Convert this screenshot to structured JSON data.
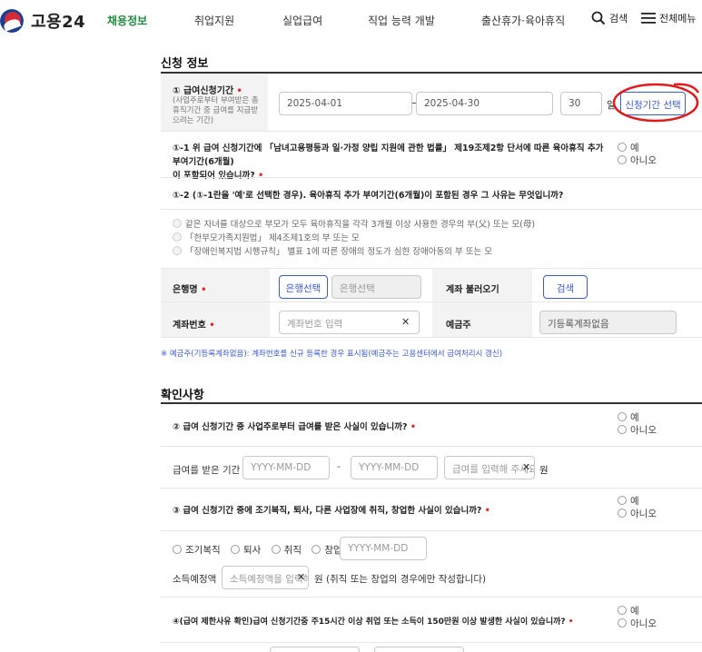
{
  "header": {
    "logo_text": "고용24",
    "nav": [
      "채용정보",
      "취업지원",
      "실업급여",
      "직업 능력 개발",
      "출산휴가·육아휴직"
    ],
    "search_label": "검색",
    "menu_label": "전체메뉴"
  },
  "apply": {
    "title": "신청 정보",
    "period_label": "① 급여신청기간",
    "period_help": "(사업주로부터 부여받은 총 휴직기간 중 급여를 지급받으려는 기간)",
    "start_date": "2025-04-01",
    "end_date": "2025-04-30",
    "days": "30",
    "days_unit": "일",
    "period_button": "신청기간 선택",
    "q1_1_line1": "①-1 위 급여 신청기간에 「남녀고용평등과 일·가정 양립 지원에 관한 법률」 제19조제2항 단서에 따른 육아휴직 추가 부여기간(6개월)",
    "q1_1_line2": "이 포함되어 있습니까?",
    "q1_2": "①-2 (①-1란을 '예'로 선택한 경우). 육아휴직 추가 부여기간(6개월)이 포함된 경우 그 사유는 무엇입니까?",
    "reasons": [
      "같은 자녀를 대상으로 부모가 모두 육아휴직을 각각 3개월 이상 사용한 경우의 부(父) 또는 모(母)",
      "「한부모가족지원법」 제4조제1호의 부 또는 모",
      "「장애인복지법 시행규칙」 별표 1에 따른 장애의 정도가 심한 장애아동의 부 또는 모"
    ],
    "yes": "예",
    "no": "아니오",
    "bank_label": "은행명",
    "bank_button": "은행선택",
    "bank_placeholder": "은행선택",
    "account_fetch_label": "계좌 불러오기",
    "search_button": "검색",
    "account_label": "계좌번호",
    "account_placeholder": "계좌번호 입력",
    "holder_label": "예금주",
    "holder_value": "기등록계좌없음",
    "notice": "※ 예금주(기등록계좌없음): 계좌번호를 신규 등록한 경우 표시됨(예금주는 고용센터에서 급여처리시 갱신)"
  },
  "confirm": {
    "title": "확인사항",
    "q2": "② 급여 신청기간 중 사업주로부터 급여를 받은 사실이 있습니까?",
    "q2_period_label": "급여를 받은 기간",
    "date_placeholder": "YYYY-MM-DD",
    "amount_placeholder": "급여를 입력해 주세요",
    "won": "원",
    "q3": "③ 급여 신청기간 중에 조기복직, 퇴사, 다른 사업장에 취직, 창업한 사실이 있습니까?",
    "q3_options": [
      "조기복직",
      "퇴사",
      "취직",
      "창업"
    ],
    "income_label": "소득예정액",
    "income_placeholder": "소득예정액을 입력해 주세요",
    "income_note": "원 (취직 또는 창업의 경우에만 작성합니다)",
    "q4": "④(급여 제한사유 확인)급여 신청기간중 주15시간 이상 취업 또는 소득이 150만원 이상 발생한 사실이 있습니까?"
  },
  "colors": {
    "accent_green": "#1f8a3c",
    "required_red": "#e0262d",
    "button_blue": "#3b5bd6",
    "highlight_red": "#e01b1b"
  }
}
